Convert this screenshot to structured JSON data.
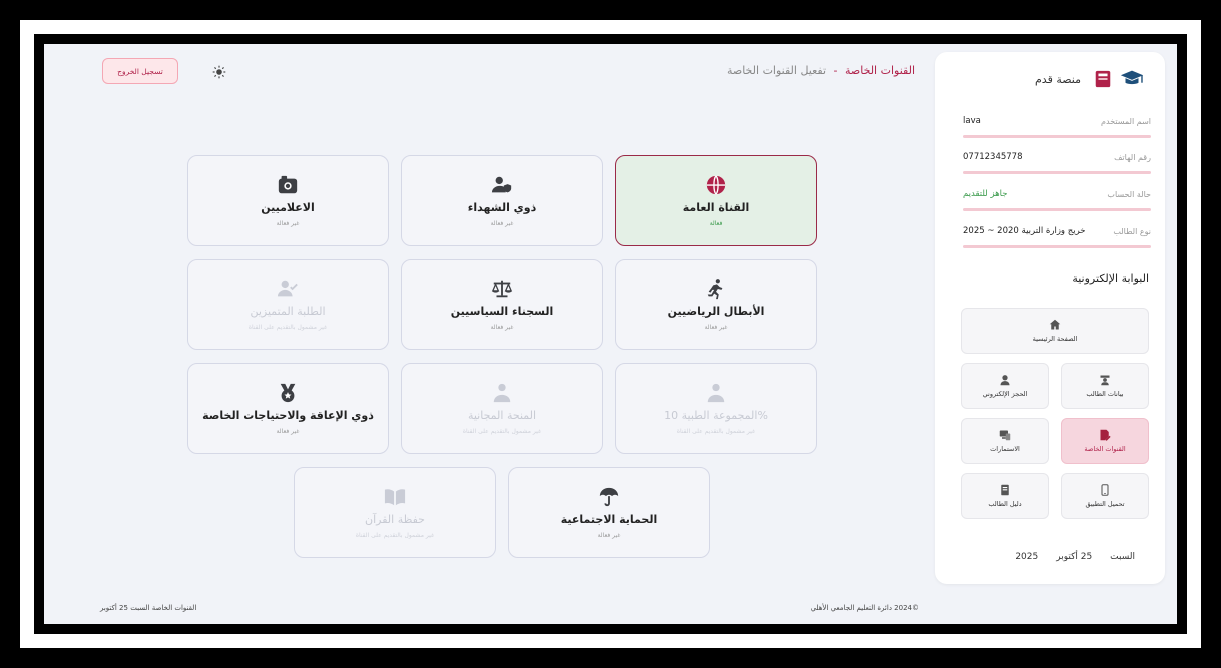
{
  "header": {
    "title_main": "القنوات الخاصة",
    "title_sep": "-",
    "title_sub": "تفعيل القنوات الخاصة",
    "logout_label": "تسجيل الخروج"
  },
  "sidebar": {
    "brand": "منصة قدم",
    "info": [
      {
        "label": "اسم المستخدم",
        "value": "lava"
      },
      {
        "label": "رقم الهاتف",
        "value": "07712345778"
      },
      {
        "label": "حالة الحساب",
        "value": "جاهز للتقديم"
      },
      {
        "label": "نوع الطالب",
        "value": "خريج وزارة التربية 2020 ~ 2025"
      }
    ],
    "portal_title": "البوابة الإلكترونية",
    "nav": {
      "home": "الصفحة الرئيسية",
      "student_data": "بيانات الطالب",
      "electronic_booking": "الحجز الإلكتروني",
      "special_channels": "القنوات الخاصة",
      "forms": "الاستمارات",
      "download_app": "تحميل التطبيق",
      "student_guide": "دليل الطالب"
    },
    "date": {
      "day": "السبت",
      "day_month": "25 أكتوبر",
      "year": "2025"
    }
  },
  "cards": {
    "general": {
      "title": "القناة العامة",
      "status": "فعالة"
    },
    "martyrs": {
      "title": "ذوي الشهداء",
      "status": "غير فعالة"
    },
    "media": {
      "title": "الاعلاميين",
      "status": "غير فعالة"
    },
    "athletes": {
      "title": "الأبطال الرياضيين",
      "status": "غير فعالة"
    },
    "prisoners": {
      "title": "السجناء السياسيين",
      "status": "غير فعالة"
    },
    "distinguished": {
      "title": "الطلبة المتميزين",
      "status": "غير مشمول بالتقديم على القناة"
    },
    "medical": {
      "title": "%المجموعة الطبية 10",
      "status": "غير مشمول بالتقديم على القناة"
    },
    "free_grant": {
      "title": "المنحة المجانية",
      "status": "غير مشمول بالتقديم على القناة"
    },
    "disability": {
      "title": "ذوي الإعاقة والاحتياجات الخاصة",
      "status": "غير فعالة"
    },
    "social": {
      "title": "الحماية الاجتماعية",
      "status": "غير فعالة"
    },
    "quran": {
      "title": "حفظة القرآن",
      "status": "غير مشمول بالتقديم على القناة"
    }
  },
  "footer": {
    "right": "©2024 دائرة التعليم الجامعي الأهلي",
    "left": "القنوات الخاصة  السبت  25 أكتوبر"
  },
  "colors": {
    "accent": "#b0224a",
    "active_card_bg": "#e4f0e6",
    "ok": "#3a9a4b"
  }
}
